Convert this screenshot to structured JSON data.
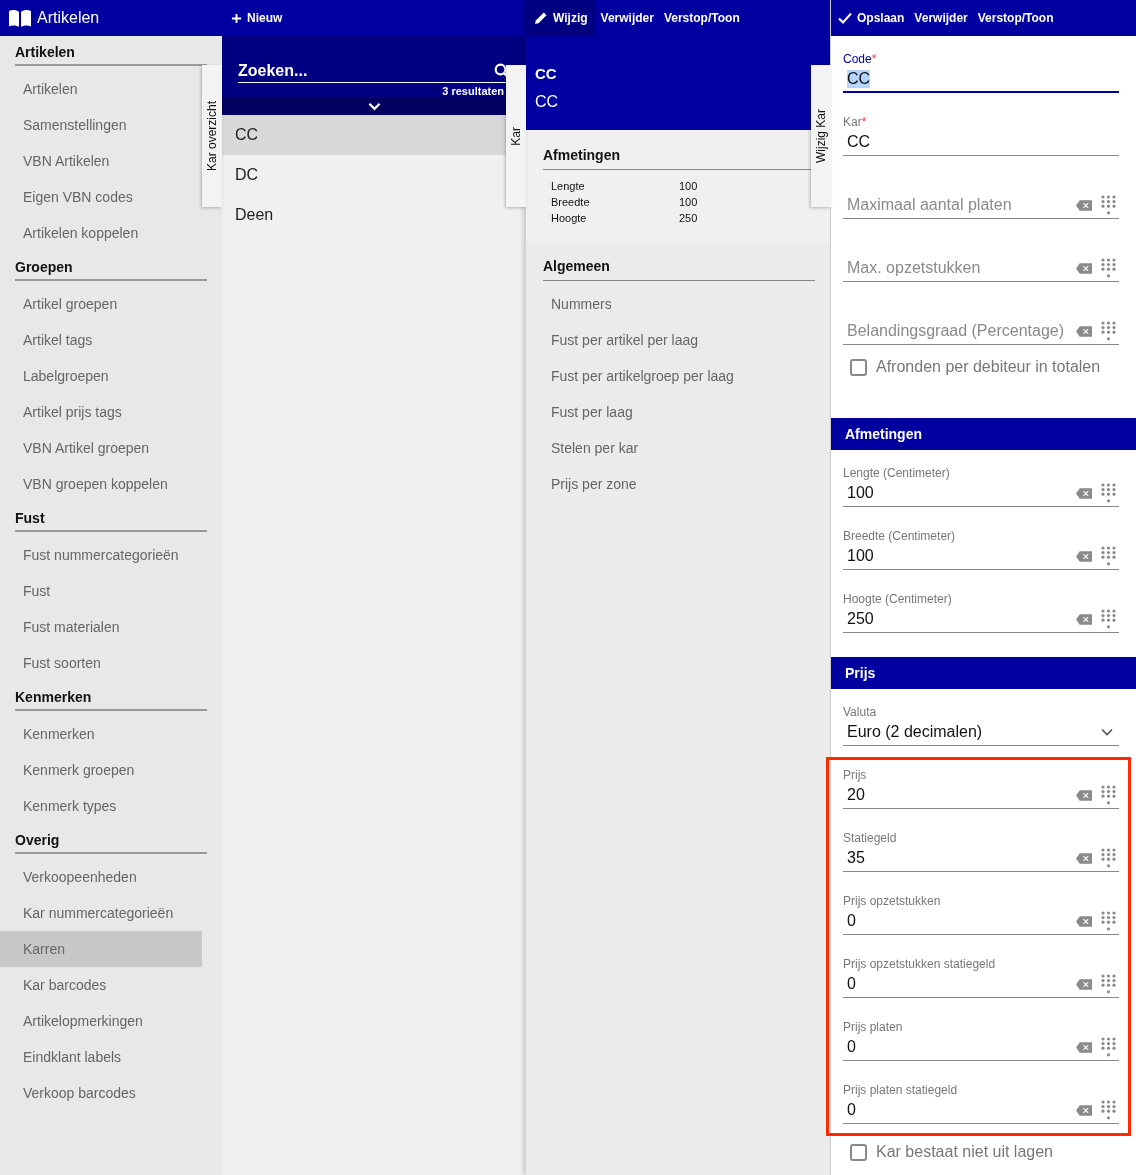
{
  "sidebar": {
    "title": "Artikelen",
    "groups": [
      {
        "heading": "Artikelen",
        "items": [
          {
            "label": "Artikelen",
            "selected": false
          },
          {
            "label": "Samenstellingen",
            "selected": false
          },
          {
            "label": "VBN Artikelen",
            "selected": false
          },
          {
            "label": "Eigen VBN codes",
            "selected": false
          },
          {
            "label": "Artikelen koppelen",
            "selected": false
          }
        ]
      },
      {
        "heading": "Groepen",
        "items": [
          {
            "label": "Artikel groepen",
            "selected": false
          },
          {
            "label": "Artikel tags",
            "selected": false
          },
          {
            "label": "Labelgroepen",
            "selected": false
          },
          {
            "label": "Artikel prijs tags",
            "selected": false
          },
          {
            "label": "VBN Artikel groepen",
            "selected": false
          },
          {
            "label": "VBN groepen koppelen",
            "selected": false
          }
        ]
      },
      {
        "heading": "Fust",
        "items": [
          {
            "label": "Fust nummercategorieën",
            "selected": false
          },
          {
            "label": "Fust",
            "selected": false
          },
          {
            "label": "Fust materialen",
            "selected": false
          },
          {
            "label": "Fust soorten",
            "selected": false
          }
        ]
      },
      {
        "heading": "Kenmerken",
        "items": [
          {
            "label": "Kenmerken",
            "selected": false
          },
          {
            "label": "Kenmerk groepen",
            "selected": false
          },
          {
            "label": "Kenmerk types",
            "selected": false
          }
        ]
      },
      {
        "heading": "Overig",
        "items": [
          {
            "label": "Verkoopeenheden",
            "selected": false
          },
          {
            "label": "Kar nummercategorieën",
            "selected": false
          },
          {
            "label": "Karren",
            "selected": true
          },
          {
            "label": "Kar barcodes",
            "selected": false
          },
          {
            "label": "Artikelopmerkingen",
            "selected": false
          },
          {
            "label": "Eindklant labels",
            "selected": false
          },
          {
            "label": "Verkoop barcodes",
            "selected": false
          }
        ]
      }
    ]
  },
  "list_panel": {
    "side_tab": "Kar overzicht",
    "actions": [
      {
        "label": "Nieuw",
        "selected": false
      }
    ],
    "search": {
      "placeholder": "Zoeken...",
      "results": "3 resultaten"
    },
    "items": [
      {
        "label": "CC",
        "selected": true
      },
      {
        "label": "DC",
        "selected": false
      },
      {
        "label": "Deen",
        "selected": false
      }
    ]
  },
  "detail_panel": {
    "side_tab": "Kar",
    "actions": [
      {
        "label": "Wijzig",
        "selected": true
      },
      {
        "label": "Verwijder",
        "selected": false
      },
      {
        "label": "Verstop/Toon",
        "selected": false
      }
    ],
    "title": "CC",
    "subtitle": "CC",
    "sections": [
      {
        "heading": "Afmetingen",
        "kind": "table",
        "rows": [
          {
            "label": "Lengte",
            "value": "100"
          },
          {
            "label": "Breedte",
            "value": "100"
          },
          {
            "label": "Hoogte",
            "value": "250"
          }
        ]
      },
      {
        "heading": "Algemeen",
        "kind": "links",
        "items": [
          "Nummers",
          "Fust per artikel per laag",
          "Fust per artikelgroep per laag",
          "Fust per laag",
          "Stelen per kar",
          "Prijs per zone"
        ]
      }
    ]
  },
  "form_panel": {
    "side_tab": "Wijzig Kar",
    "actions": [
      {
        "label": "Opslaan",
        "selected": false
      },
      {
        "label": "Verwijder",
        "selected": false
      },
      {
        "label": "Verstop/Toon",
        "selected": false
      }
    ],
    "sections": [
      {
        "items": [
          {
            "kind": "text",
            "label": "Code",
            "required_mark": "*",
            "focused": true,
            "value": "CC"
          },
          {
            "kind": "text",
            "label": "Kar",
            "required_mark": "*",
            "focused": false,
            "value": "CC"
          },
          {
            "kind": "number",
            "placeholder": "Maximaal aantal platen"
          },
          {
            "kind": "number",
            "placeholder": "Max. opzetstukken"
          },
          {
            "kind": "number",
            "placeholder": "Belandingsgraad (Percentage)"
          },
          {
            "kind": "checkbox",
            "label": "Afronden per debiteur in totalen",
            "checked": false
          }
        ]
      },
      {
        "heading": "Afmetingen",
        "items": [
          {
            "kind": "number",
            "label": "Lengte (Centimeter)",
            "value": "100"
          },
          {
            "kind": "number",
            "label": "Breedte (Centimeter)",
            "value": "100"
          },
          {
            "kind": "number",
            "label": "Hoogte (Centimeter)",
            "value": "250"
          }
        ]
      },
      {
        "heading": "Prijs",
        "items": [
          {
            "kind": "select",
            "label": "Valuta",
            "value": "Euro (2 decimalen)"
          },
          {
            "kind": "group",
            "highlighted": true,
            "items": [
              {
                "kind": "number",
                "label": "Prijs",
                "value": "20"
              },
              {
                "kind": "number",
                "label": "Statiegeld",
                "value": "35"
              },
              {
                "kind": "number",
                "label": "Prijs opzetstukken",
                "value": "0"
              },
              {
                "kind": "number",
                "label": "Prijs opzetstukken statiegeld",
                "value": "0"
              },
              {
                "kind": "number",
                "label": "Prijs platen",
                "value": "0"
              },
              {
                "kind": "number",
                "label": "Prijs platen statiegeld",
                "value": "0"
              }
            ]
          },
          {
            "kind": "checkbox",
            "label": "Kar bestaat niet uit lagen",
            "checked": false
          }
        ]
      }
    ]
  }
}
